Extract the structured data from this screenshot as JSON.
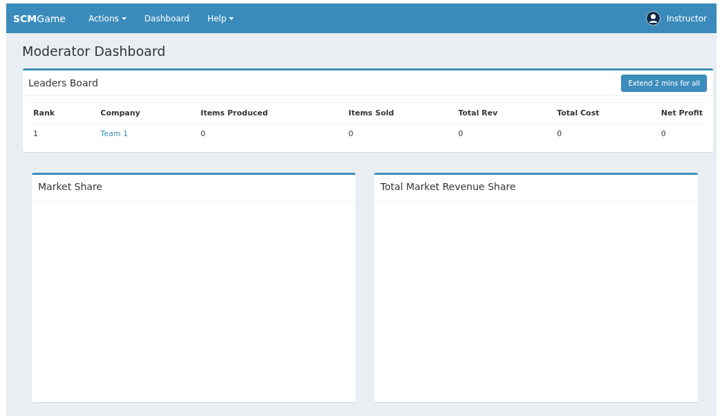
{
  "navbar": {
    "brand": "**SCM**Game",
    "menu": [
      {
        "label": "Actions",
        "dropdown": true
      },
      {
        "label": "Dashboard",
        "dropdown": false
      },
      {
        "label": "Help",
        "dropdown": true
      }
    ],
    "user": "Instructor"
  },
  "page_title": "Moderator Dashboard",
  "leaders_board": {
    "title": "Leaders Board",
    "button": "Extend 2 mins for all",
    "columns": [
      "Rank",
      "Company",
      "Items Produced",
      "Items Sold",
      "Total Rev",
      "Total Cost",
      "Net Profit"
    ],
    "rows": [
      {
        "cells": [
          "1",
          "Team 1",
          "0",
          "0",
          "0",
          "0",
          "0"
        ]
      }
    ]
  },
  "panels": [
    {
      "title": "Market Share"
    },
    {
      "title": "Total Market Revenue Share"
    }
  ]
}
